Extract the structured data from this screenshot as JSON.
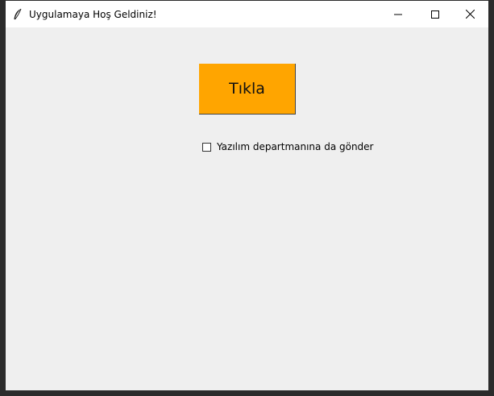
{
  "window": {
    "title": "Uygulamaya Hoş Geldiniz!",
    "icon": "feather-icon",
    "controls": [
      "minimize-icon",
      "maximize-icon",
      "close-icon"
    ]
  },
  "main": {
    "button_label": "Tıkla",
    "button_color": "#ffa500",
    "checkbox_label": "Yazılım departmanına da gönder",
    "checkbox_checked": false
  }
}
